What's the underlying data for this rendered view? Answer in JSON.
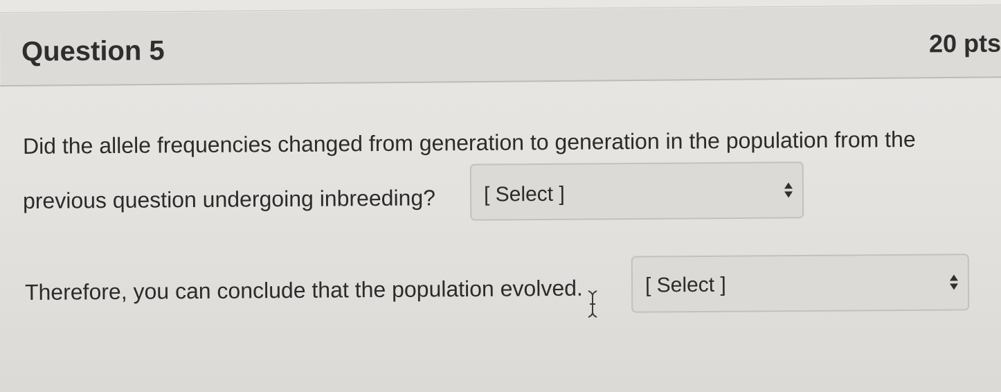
{
  "question": {
    "title": "Question 5",
    "points": "20 pts"
  },
  "body": {
    "line1": "Did the allele frequencies changed from generation to generation in the population from the",
    "line2": "previous question undergoing inbreeding?",
    "line3": "Therefore, you can conclude that the population evolved."
  },
  "selects": [
    {
      "selected": "[ Select ]",
      "icon": "up-down-arrows-icon"
    },
    {
      "selected": "[ Select ]",
      "icon": "up-down-arrows-icon"
    }
  ],
  "colors": {
    "background": "#e6e4e1",
    "header": "#dddbd8",
    "text": "#2b2b2b",
    "select_border": "#c3c1be"
  }
}
